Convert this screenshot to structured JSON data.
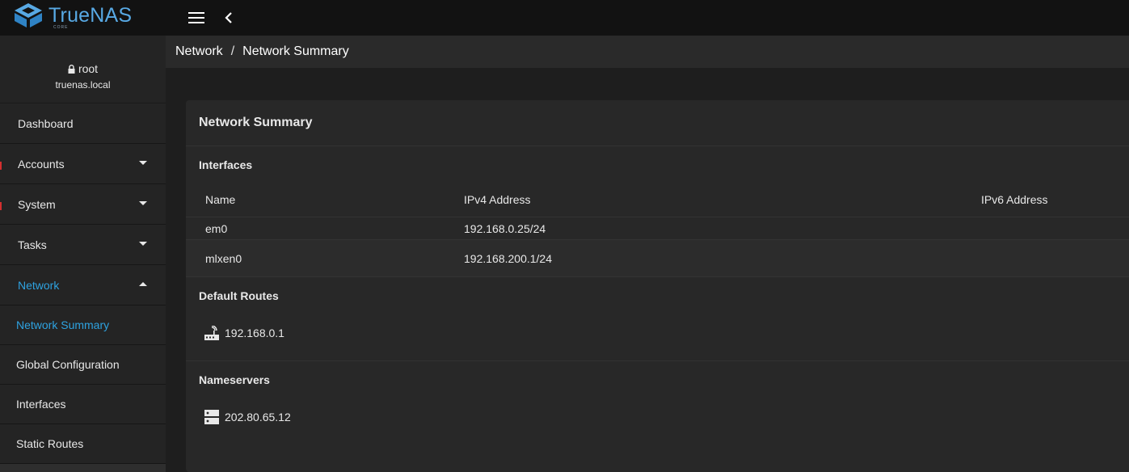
{
  "app": {
    "brand": "TrueNAS",
    "edition": "CORE",
    "accent_color": "#2ea2e0"
  },
  "user": {
    "name": "root",
    "host": "truenas.local"
  },
  "sidebar": {
    "items": [
      {
        "label": "Dashboard",
        "expandable": false
      },
      {
        "label": "Accounts",
        "expandable": true
      },
      {
        "label": "System",
        "expandable": true
      },
      {
        "label": "Tasks",
        "expandable": true
      },
      {
        "label": "Network",
        "expandable": true,
        "expanded": true
      }
    ],
    "network_children": [
      {
        "label": "Network Summary",
        "active": true
      },
      {
        "label": "Global Configuration"
      },
      {
        "label": "Interfaces"
      },
      {
        "label": "Static Routes"
      }
    ]
  },
  "breadcrumb": {
    "parent": "Network",
    "separator": "/",
    "current": "Network Summary"
  },
  "card": {
    "title": "Network Summary",
    "interfaces": {
      "title": "Interfaces",
      "columns": [
        "Name",
        "IPv4 Address",
        "IPv6 Address"
      ],
      "rows": [
        {
          "name": "em0",
          "ipv4": "192.168.0.25/24",
          "ipv6": ""
        },
        {
          "name": "mlxen0",
          "ipv4": "192.168.200.1/24",
          "ipv6": ""
        }
      ]
    },
    "default_routes": {
      "title": "Default Routes",
      "icon": "router-icon",
      "value": "192.168.0.1"
    },
    "nameservers": {
      "title": "Nameservers",
      "icon": "dns-server-icon",
      "value": "202.80.65.12"
    }
  }
}
